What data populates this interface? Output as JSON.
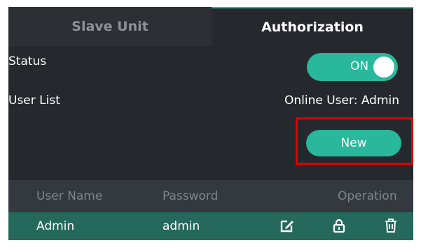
{
  "tabs": [
    {
      "label": "Slave Unit",
      "active": false
    },
    {
      "label": "Authorization",
      "active": true
    }
  ],
  "status": {
    "label": "Status",
    "toggle_text": "ON",
    "on": true
  },
  "user_list": {
    "label": "User List",
    "online_user": "Online User: Admin",
    "new_button": "New"
  },
  "table": {
    "headers": [
      "User Name",
      "Password",
      "Operation"
    ],
    "rows": [
      {
        "user_name": "Admin",
        "password": "admin",
        "operations": [
          "edit-icon",
          "lock-icon",
          "trash-icon"
        ]
      }
    ]
  },
  "colors": {
    "accent": "#29b89b",
    "highlight_box": "#e10000",
    "row_selected": "#25695c",
    "panel_bg": "#25292d"
  }
}
